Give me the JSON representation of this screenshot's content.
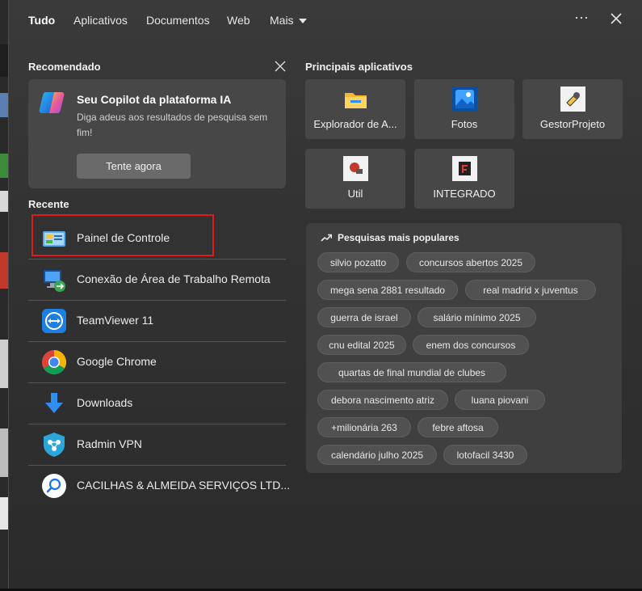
{
  "nav": {
    "tabs": [
      "Tudo",
      "Aplicativos",
      "Documentos",
      "Web",
      "Mais"
    ],
    "more_icon": "ellipsis-icon",
    "close_icon": "close-icon"
  },
  "recommended": {
    "title": "Recomendado",
    "card_title": "Seu Copilot da plataforma IA",
    "card_desc": "Diga adeus aos resultados de pesquisa sem fim!",
    "button": "Tente agora"
  },
  "recent": {
    "title": "Recente",
    "items": [
      {
        "label": "Painel de Controle",
        "icon": "control-panel-icon"
      },
      {
        "label": "Conexão de Área de Trabalho Remota",
        "icon": "remote-desktop-icon"
      },
      {
        "label": "TeamViewer 11",
        "icon": "teamviewer-icon"
      },
      {
        "label": "Google Chrome",
        "icon": "chrome-icon"
      },
      {
        "label": "Downloads",
        "icon": "download-arrow-icon"
      },
      {
        "label": "Radmin VPN",
        "icon": "radmin-vpn-icon"
      },
      {
        "label": "CACILHAS & ALMEIDA SERVIÇOS LTD...",
        "icon": "search-web-icon"
      }
    ]
  },
  "top_apps": {
    "title": "Principais aplicativos",
    "items": [
      {
        "label": "Explorador de A...",
        "icon": "file-explorer-icon"
      },
      {
        "label": "Fotos",
        "icon": "photos-icon"
      },
      {
        "label": "GestorProjeto",
        "icon": "gestorprojeto-icon"
      },
      {
        "label": "Util",
        "icon": "util-icon"
      },
      {
        "label": "INTEGRADO",
        "icon": "integrado-icon"
      }
    ]
  },
  "popular": {
    "title": "Pesquisas mais populares",
    "chips": [
      "silvio pozatto",
      "concursos abertos 2025",
      "mega sena 2881 resultado",
      "real madrid x juventus",
      "guerra de israel",
      "salário mínimo 2025",
      "cnu edital 2025",
      "enem dos concursos",
      "quartas de final mundial de clubes",
      "debora nascimento atriz",
      "luana piovani",
      "+milionária 263",
      "febre aftosa",
      "calendário julho 2025",
      "lotofacil 3430"
    ]
  },
  "colors": {
    "highlight": "#e01b1b",
    "panel": "#3a3a3a",
    "card": "#474747"
  }
}
